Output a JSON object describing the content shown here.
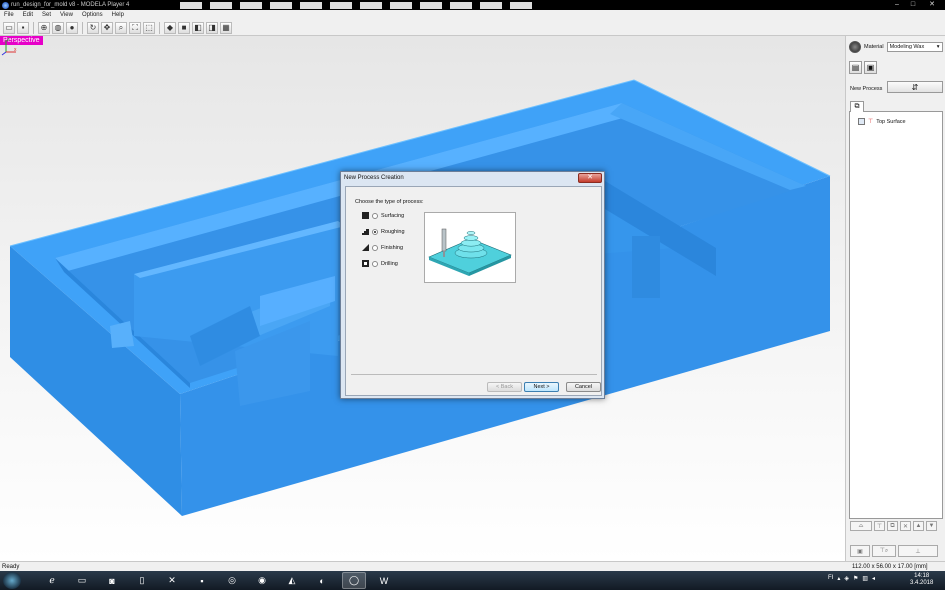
{
  "window": {
    "title": "run_design_for_mold v8 - MODELA Player 4",
    "minimize_glyph": "–",
    "maximize_glyph": "□",
    "close_glyph": "✕"
  },
  "menu": [
    "File",
    "Edit",
    "Set",
    "View",
    "Options",
    "Help"
  ],
  "toolbar": {
    "icons": [
      "open-icon",
      "save-icon",
      "rotate-view-icon",
      "globe-icon",
      "sphere-icon",
      "refresh-icon",
      "pan-icon",
      "zoom-icon",
      "fit-icon",
      "zoom-box-icon",
      "view-iso-icon",
      "view-front-icon",
      "view-side-icon",
      "view-top-icon",
      "grid-icon"
    ]
  },
  "viewport": {
    "view_label": "Perspective",
    "model_color": "#3d9bf2"
  },
  "panel": {
    "material_label": "Material",
    "material_value": "Modeling Wax",
    "new_process_label": "New Process",
    "tree": {
      "items": [
        {
          "label": "Top Surface"
        }
      ]
    }
  },
  "dialog": {
    "title": "New Process Creation",
    "close_glyph": "✕",
    "prompt": "Choose the type of process:",
    "options": [
      {
        "label": "Surfacing",
        "selected": false
      },
      {
        "label": "Roughing",
        "selected": true
      },
      {
        "label": "Finishing",
        "selected": false
      },
      {
        "label": "Drilling",
        "selected": false
      }
    ],
    "buttons": {
      "back": "< Back",
      "next": "Next >",
      "cancel": "Cancel"
    }
  },
  "statusbar": {
    "status": "Ready",
    "dimensions": "112.00 x 56.00 x 17.00 [mm]"
  },
  "taskbar": {
    "tray_lang": "FI",
    "time": "14:18",
    "date": "3.4.2018"
  }
}
